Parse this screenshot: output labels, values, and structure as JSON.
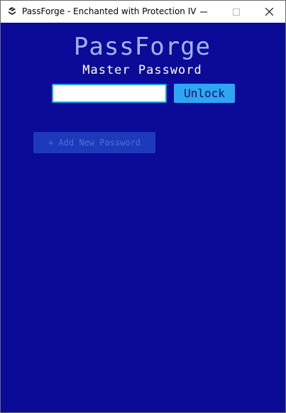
{
  "window": {
    "title": "PassForge - Enchanted with Protection IV",
    "app_icon": "passforge-logo-icon",
    "controls": {
      "minimize_icon": "minimize-icon",
      "maximize_icon": "maximize-icon",
      "close_icon": "close-icon"
    }
  },
  "main": {
    "app_title": "PassForge",
    "subtitle": "Master Password",
    "password_input": {
      "value": "",
      "placeholder": ""
    },
    "unlock_label": "Unlock",
    "add_new_label": "+ Add New Password"
  },
  "colors": {
    "background": "#0b0b98",
    "title_text": "#9fb6f2",
    "accent": "#2fa6f4",
    "add_button_bg": "#1d3abb",
    "add_button_text": "#4b6fd8",
    "input_border": "#1fa0e8"
  }
}
